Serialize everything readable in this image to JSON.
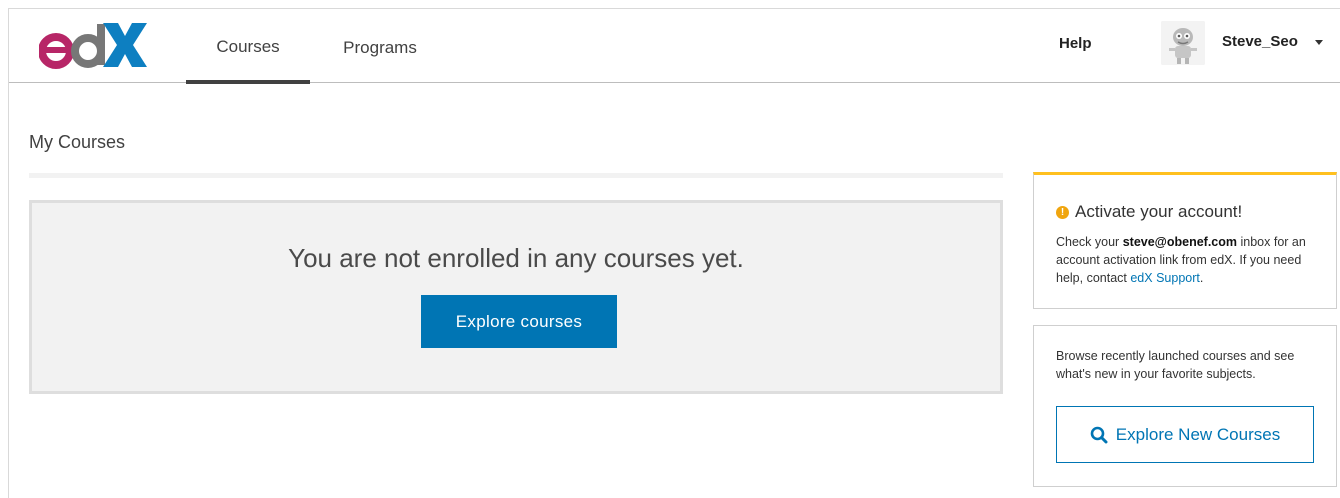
{
  "header": {
    "logo_text": "edX",
    "tabs": [
      {
        "label": "Courses",
        "active": true
      },
      {
        "label": "Programs",
        "active": false
      }
    ],
    "help_label": "Help",
    "username": "Steve_Seo"
  },
  "main": {
    "title": "My Courses",
    "empty_message": "You are not enrolled in any courses yet.",
    "explore_button": "Explore courses"
  },
  "sidebar": {
    "activate": {
      "title": "Activate your account!",
      "text_before": "Check your ",
      "email": "steve@obenef.com",
      "text_after": " inbox for an account activation link from edX. If you need help, contact ",
      "support_link": "edX Support",
      "text_end": "."
    },
    "browse": {
      "text": "Browse recently launched courses and see what's new in your favorite subjects.",
      "button_label": "Explore New Courses"
    }
  },
  "colors": {
    "brand_blue": "#0075b4",
    "warning_yellow": "#ffc01f",
    "logo_magenta": "#b72667",
    "logo_gray": "#777777",
    "logo_blue": "#0d7fc1"
  },
  "icons": [
    "warning-icon",
    "search-icon",
    "chevron-down-icon"
  ]
}
